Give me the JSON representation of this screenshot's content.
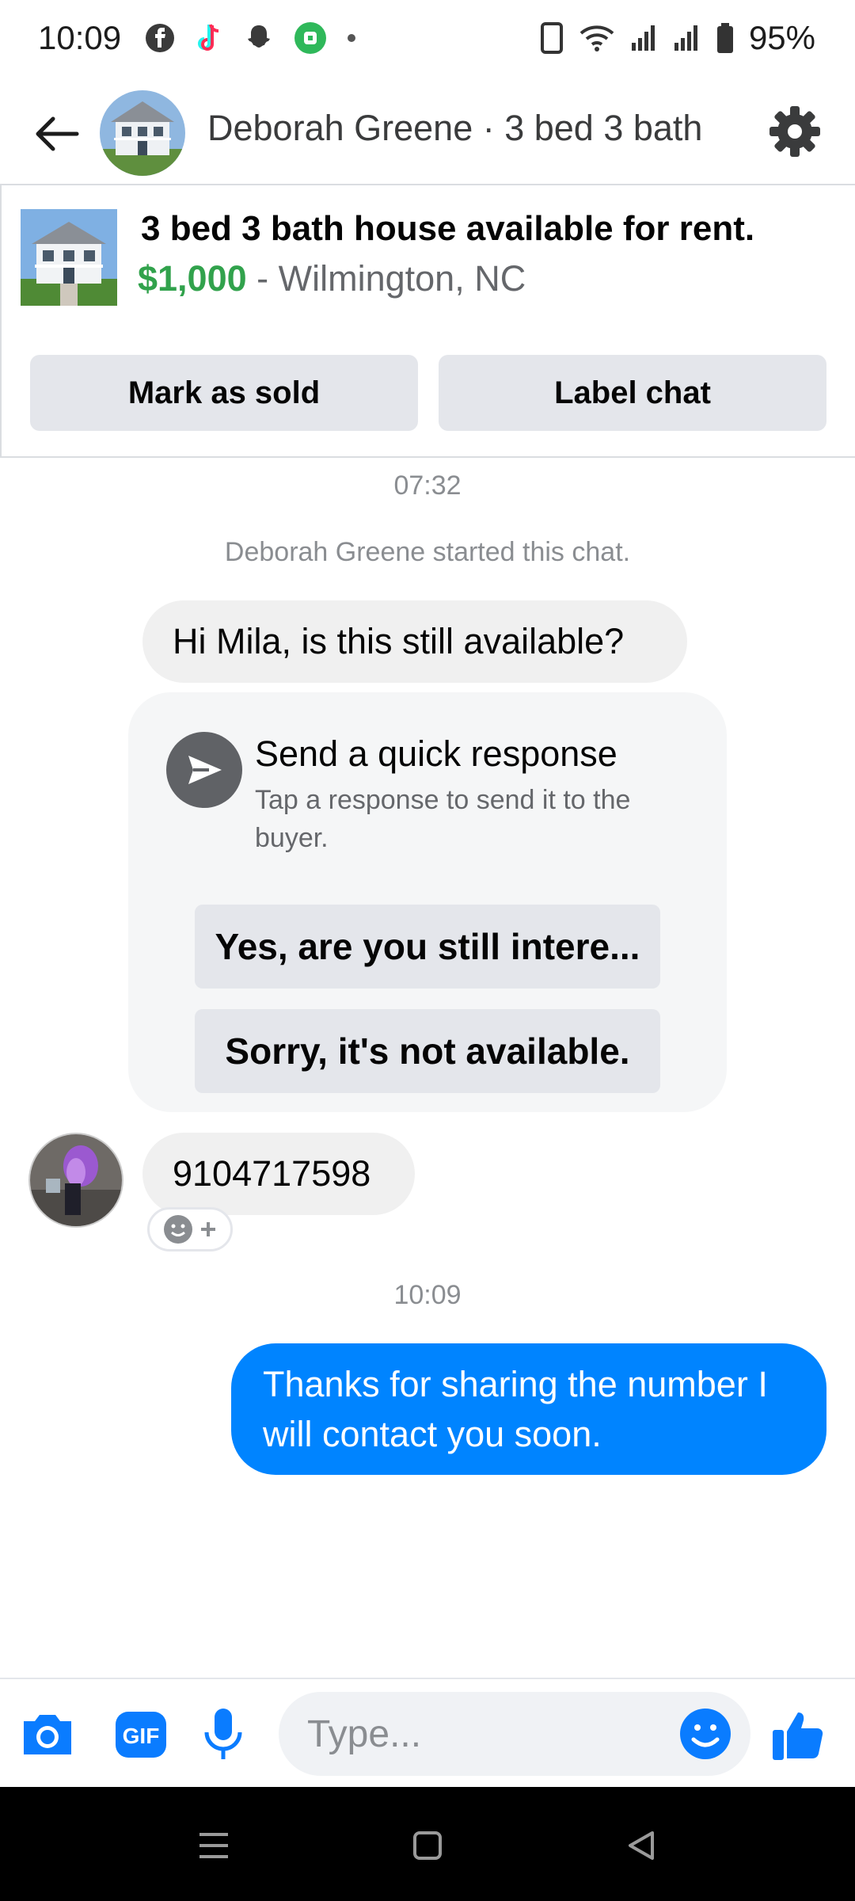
{
  "status_bar": {
    "time": "10:09",
    "battery": "95%",
    "left_icons": [
      "facebook-icon",
      "tiktok-icon",
      "snapchat-icon",
      "app-icon",
      "dot-icon"
    ],
    "right_icons": [
      "phone-icon",
      "wifi-icon",
      "signal-icon",
      "signal-icon",
      "battery-icon"
    ]
  },
  "header": {
    "title": "Deborah Greene · 3 bed 3 bath"
  },
  "listing": {
    "title": "3 bed 3 bath house available for rent.",
    "price": "$1,000",
    "location": "- Wilmington, NC",
    "mark_sold_label": "Mark as sold",
    "label_chat_label": "Label chat"
  },
  "chat": {
    "timestamp_1": "07:32",
    "system_message": "Deborah Greene started this chat.",
    "message_1": "Hi Mila, is this still available?",
    "quick_response": {
      "title": "Send a quick response",
      "subtitle": "Tap a response to send it to the buyer.",
      "option_1": "Yes, are you still intere...",
      "option_2": "Sorry, it's not available."
    },
    "message_2": "9104717598",
    "timestamp_2": "10:09",
    "message_3": "Thanks for sharing the number I will contact you soon."
  },
  "composer": {
    "placeholder": "Type...",
    "icons": [
      "camera-icon",
      "gif-icon",
      "microphone-icon",
      "emoji-icon",
      "thumbs-up-icon"
    ],
    "gif_label": "GIF"
  },
  "colors": {
    "accent": "#0084ff",
    "price_green": "#31a24c",
    "bubble_gray": "#f0f0f0"
  }
}
